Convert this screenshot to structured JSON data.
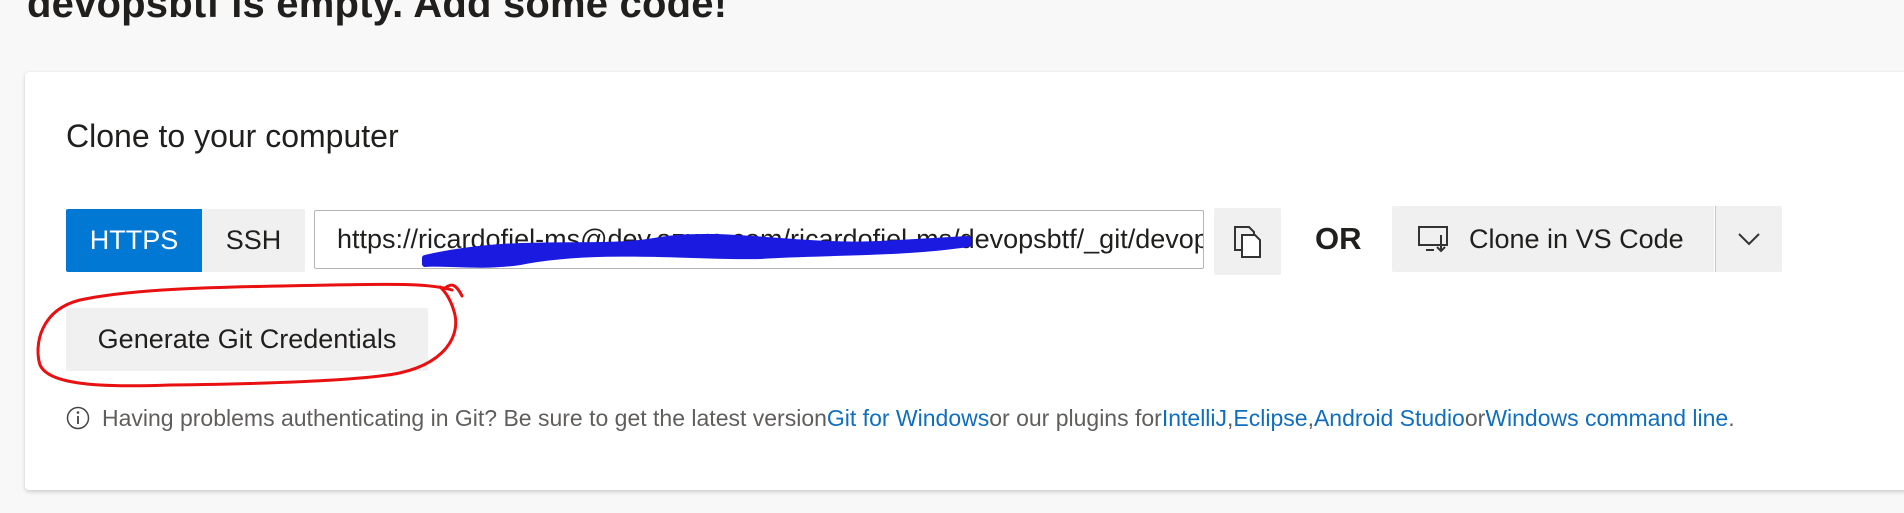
{
  "page": {
    "title": "devopsbtf is empty. Add some code!"
  },
  "clone": {
    "heading": "Clone to your computer",
    "protocols": [
      "HTTPS",
      "SSH"
    ],
    "selected_protocol": "HTTPS",
    "url": "https://ricardofiel-ms@dev.azure.com/ricardofiel-ms/devopsbtf/_git/devopsbtf",
    "or_label": "OR",
    "vscode_label": "Clone in VS Code",
    "generate_label": "Generate Git Credentials"
  },
  "help": {
    "prefix": "Having problems authenticating in Git? Be sure to get the latest version ",
    "link_git_windows": "Git for Windows",
    "middle": " or our plugins for ",
    "link_intellij": "IntelliJ",
    "comma1": ", ",
    "link_eclipse": "Eclipse",
    "comma2": ", ",
    "link_android_studio": "Android Studio",
    "or_text": " or ",
    "link_windows_cmd": "Windows command line",
    "suffix": "."
  },
  "colors": {
    "accent": "#0078d4",
    "link": "#106ebe",
    "annotation_red": "#e81010",
    "redaction_blue": "#1010e0"
  },
  "icons": {
    "copy": "copy-icon",
    "vscode": "monitor-download-icon",
    "dropdown": "chevron-down-icon",
    "info": "info-icon"
  }
}
